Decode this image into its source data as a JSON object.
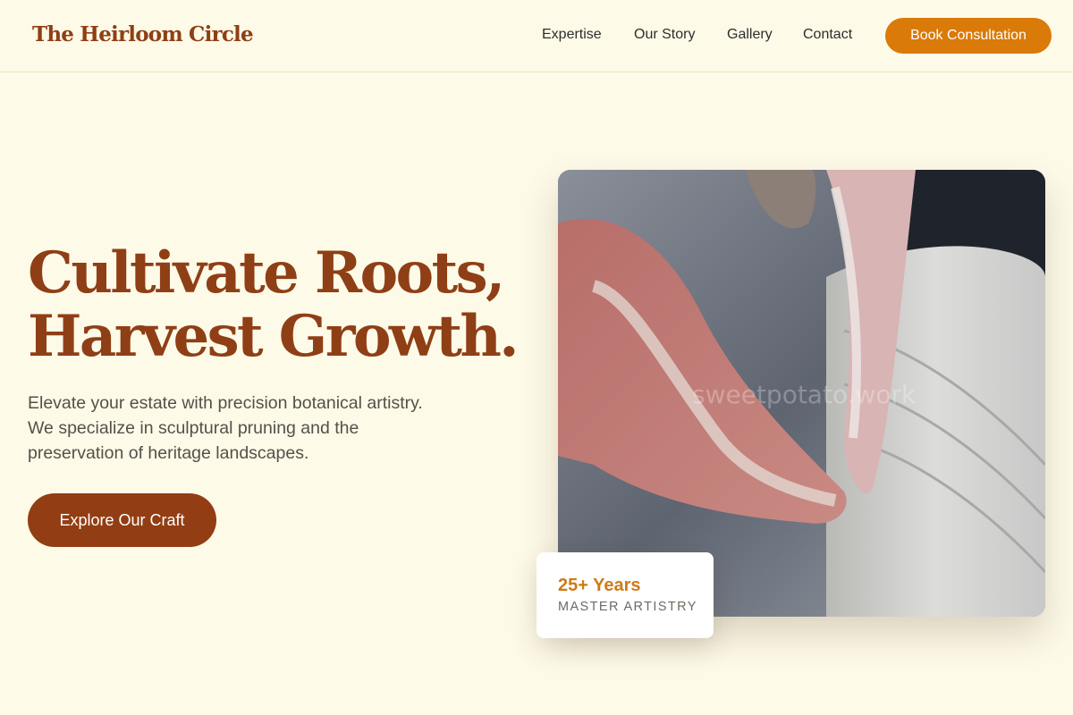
{
  "header": {
    "brand": "The Heirloom Circle",
    "nav": [
      "Expertise",
      "Our Story",
      "Gallery",
      "Contact"
    ],
    "cta": "Book Consultation"
  },
  "hero": {
    "headline_line1": "Cultivate Roots,",
    "headline_line2": "Harvest Growth.",
    "sub_line1": "Elevate your estate with precision botanical artistry.",
    "sub_line2": "We specialize in sculptural pruning and the",
    "sub_line3": "preservation of heritage landscapes.",
    "cta": "Explore Our Craft",
    "image_watermark": "sweetpotato.work"
  },
  "stat": {
    "value": "25+ Years",
    "label": "MASTER ARTISTRY"
  },
  "colors": {
    "background": "#fefae8",
    "brand": "#8f3f15",
    "accent": "#d97a09"
  }
}
